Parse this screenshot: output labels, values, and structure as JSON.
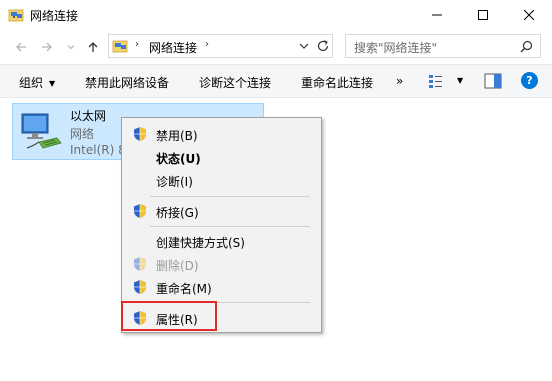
{
  "window": {
    "title": "网络连接",
    "icon": "network-folder-icon",
    "controls": [
      "minimize-icon",
      "maximize-icon",
      "close-icon"
    ]
  },
  "nav": {
    "back_icon": "back-arrow-icon",
    "forward_icon": "forward-arrow-icon",
    "recent_icon": "chevron-down-icon",
    "up_icon": "up-arrow-icon"
  },
  "address": {
    "crumb": "网络连接",
    "separator": "›"
  },
  "search": {
    "placeholder": "搜索\"网络连接\""
  },
  "toolbar": {
    "organize": "组织",
    "disable_device": "禁用此网络设备",
    "diagnose": "诊断这个连接",
    "rename": "重命名此连接",
    "more": "»",
    "help": "?"
  },
  "connection": {
    "name": "以太网",
    "status": "网络",
    "device": "Intel(R) 8"
  },
  "context_menu": {
    "items": [
      {
        "label": "禁用(B)",
        "shield": true,
        "bold": false,
        "disabled": false
      },
      {
        "label": "状态(U)",
        "shield": false,
        "bold": true,
        "disabled": false
      },
      {
        "label": "诊断(I)",
        "shield": false,
        "bold": false,
        "disabled": false
      },
      {
        "label": "桥接(G)",
        "shield": true,
        "bold": false,
        "disabled": false
      },
      {
        "label": "创建快捷方式(S)",
        "shield": false,
        "bold": false,
        "disabled": false
      },
      {
        "label": "删除(D)",
        "shield": true,
        "bold": false,
        "disabled": true
      },
      {
        "label": "重命名(M)",
        "shield": true,
        "bold": false,
        "disabled": false
      },
      {
        "label": "属性(R)",
        "shield": true,
        "bold": false,
        "disabled": false
      }
    ],
    "highlighted_item": "属性(R)"
  },
  "colors": {
    "selection_bg": "#cce8ff",
    "selection_border": "#99d1ff",
    "highlight_box": "#e02b2b",
    "shield_blue": "#2a62c9",
    "shield_gold": "#f2c12e"
  }
}
